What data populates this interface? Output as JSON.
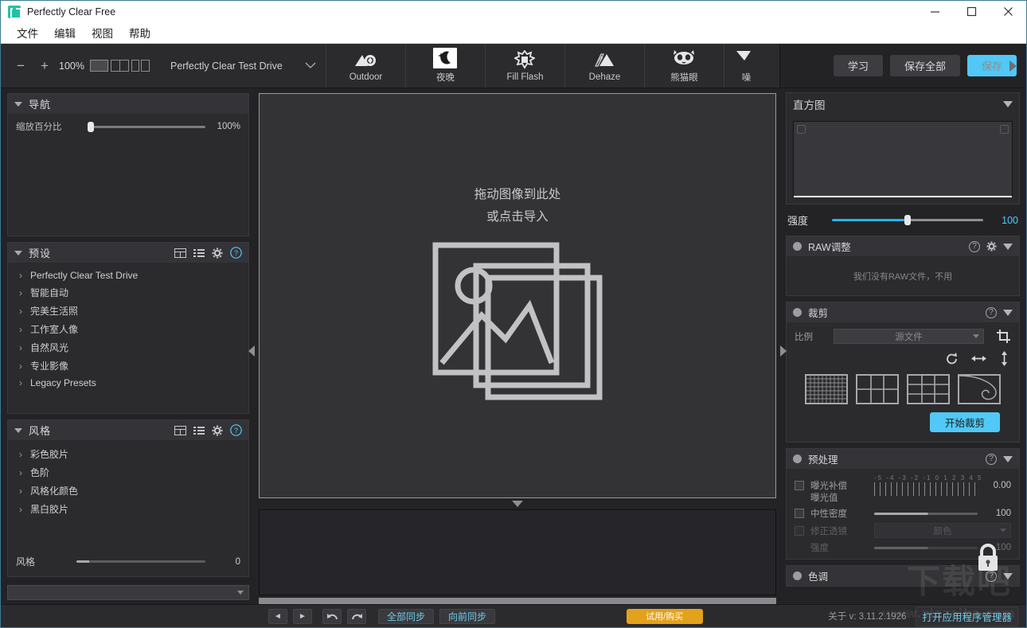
{
  "window": {
    "title": "Perfectly Clear Free",
    "logo_icon": "app-logo-icon",
    "minimize": "—",
    "maximize": "□",
    "close": "✕"
  },
  "menubar": {
    "items": [
      "文件",
      "编辑",
      "视图",
      "帮助"
    ]
  },
  "toolbar": {
    "zoom_out": "−",
    "zoom_in": "+",
    "zoom_value": "100%",
    "view_modes": [
      "single-view",
      "two-up-view",
      "split-view"
    ],
    "preset_selector": {
      "value": "Perfectly Clear Test Drive",
      "chevron": "⌄"
    },
    "tools": [
      {
        "label": "Outdoor",
        "icon": "outdoor-aperture-icon"
      },
      {
        "label": "夜晚",
        "icon": "night-moon-icon"
      },
      {
        "label": "Fill Flash",
        "icon": "fill-flash-icon"
      },
      {
        "label": "Dehaze",
        "icon": "dehaze-icon"
      },
      {
        "label": "熊猫眼",
        "icon": "panda-eye-icon"
      },
      {
        "label": "噪",
        "icon": "noise-icon"
      }
    ],
    "scroll_right": "scroll-right-arrow-icon",
    "buttons": {
      "learn": "学习",
      "save_all": "保存全部",
      "save": "保存"
    }
  },
  "left_panel": {
    "navigation": {
      "title": "导航",
      "zoom_label": "缩放百分比",
      "zoom_value": "100%",
      "zoom_fill_percent": 2
    },
    "presets": {
      "title": "预设",
      "icons": [
        "grid-view-icon",
        "list-view-icon",
        "gear-icon",
        "help-icon"
      ],
      "items": [
        "Perfectly Clear Test Drive",
        "智能自动",
        "完美生活照",
        "工作室人像",
        "自然风光",
        "专业影像",
        "Legacy Presets"
      ]
    },
    "styles": {
      "title": "风格",
      "icons": [
        "grid-view-icon",
        "list-view-icon",
        "gear-icon",
        "help-icon"
      ],
      "items": [
        "彩色胶片",
        "色阶",
        "风格化颜色",
        "黑白胶片"
      ]
    },
    "style_strength": {
      "label": "风格",
      "value": "0",
      "fill_percent": 8
    },
    "bottom_selector": {
      "value": ""
    }
  },
  "canvas": {
    "drop_line1": "拖动图像到此处",
    "drop_line2": "或点击导入",
    "placeholder_icon": "image-stack-placeholder-icon",
    "collapse_handle": "collapse-filmstrip-arrow"
  },
  "right_panel": {
    "histogram": {
      "title": "直方图",
      "collapse": "collapse-arrow"
    },
    "strength": {
      "label": "强度",
      "value": "100",
      "fill_percent": 50
    },
    "raw": {
      "title": "RAW调整",
      "message": "我们没有RAW文件，不用",
      "icons": [
        "help-icon",
        "gear-icon",
        "collapse-arrow"
      ]
    },
    "crop": {
      "title": "裁剪",
      "ratio_label": "比例",
      "ratio_value": "源文件",
      "crop_tool_icon": "crop-tool-icon",
      "rotate_icon": "rotate-icon",
      "flip_h_icon": "flip-horizontal-icon",
      "flip_v_icon": "flip-vertical-icon",
      "overlays": [
        "fine-grid-overlay",
        "thirds-grid-overlay",
        "quad-grid-overlay",
        "golden-spiral-overlay"
      ],
      "start_button": "开始裁剪"
    },
    "preprocess": {
      "title": "预处理",
      "exposure_comp_label": "曝光补偿",
      "exposure_value_label": "曝光值",
      "exposure_value": "0.00",
      "ruler_labels": "-5 -4 -3 -2 -1 0 1 2 3 4 5",
      "neutral_density_label": "中性密度",
      "neutral_density_value": "100",
      "neutral_density_fill": 52,
      "lens_correction_label": "修正透镜",
      "lens_correction_value": "颜色",
      "lens_strength_label": "强度",
      "lens_strength_value": "100",
      "lens_strength_fill": 52,
      "lock_icon": "lock-icon"
    },
    "tone": {
      "title": "色调"
    }
  },
  "status_bar": {
    "prev": "◄",
    "next": "►",
    "undo": "undo-arrow-icon",
    "redo": "redo-arrow-icon",
    "sync_all": "全部同步",
    "sync_forward": "向前同步",
    "trial": "试用/购买",
    "about": "关于 v: 3.11.2.1926",
    "app_manager": "打开应用程序管理器"
  },
  "watermark": {
    "text": "下载吧",
    "sub": "www.xiazaiba.com"
  },
  "colors": {
    "accent": "#51c8f5",
    "panel": "#2b2b2e",
    "panel_header": "#343438",
    "background": "#232326",
    "trial": "#e3a21b",
    "border": "#3d7a99"
  }
}
